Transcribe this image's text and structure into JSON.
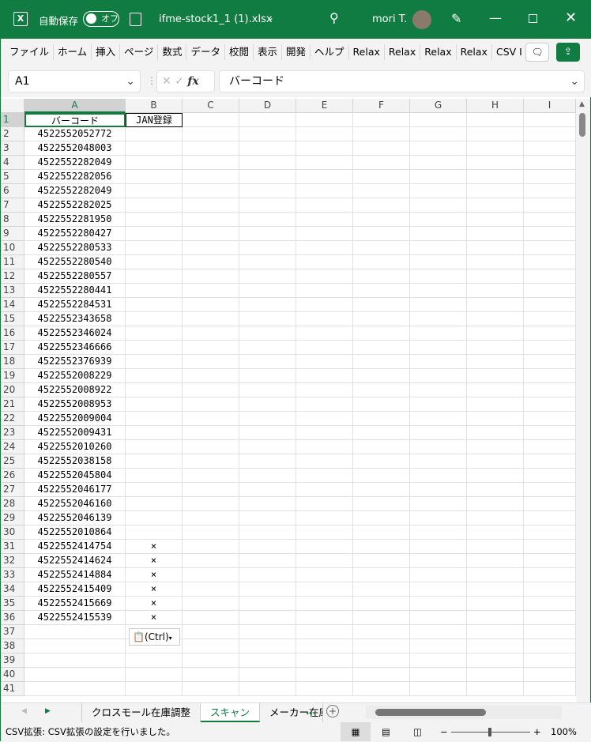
{
  "titlebar": {
    "autosave_label": "自動保存",
    "autosave_state": "オフ",
    "filename": "ifme-stock1_1 (1).xlsx",
    "user": "mori T."
  },
  "ribbon": {
    "tabs": [
      "ファイル",
      "ホーム",
      "挿入",
      "ページ",
      "数式",
      "データ",
      "校閲",
      "表示",
      "開発",
      "ヘルプ",
      "Relax",
      "Relax",
      "Relax",
      "Relax",
      "CSV I"
    ]
  },
  "formula": {
    "name_box": "A1",
    "fx": "fx",
    "content": "バーコード"
  },
  "columns": [
    "A",
    "B",
    "C",
    "D",
    "E",
    "F",
    "G",
    "H",
    "I"
  ],
  "rows": [
    [
      "バーコード",
      "JAN登録"
    ],
    [
      "4522552052772",
      ""
    ],
    [
      "4522552048003",
      ""
    ],
    [
      "4522552282049",
      ""
    ],
    [
      "4522552282056",
      ""
    ],
    [
      "4522552282049",
      ""
    ],
    [
      "4522552282025",
      ""
    ],
    [
      "4522552281950",
      ""
    ],
    [
      "4522552280427",
      ""
    ],
    [
      "4522552280533",
      ""
    ],
    [
      "4522552280540",
      ""
    ],
    [
      "4522552280557",
      ""
    ],
    [
      "4522552280441",
      ""
    ],
    [
      "4522552284531",
      ""
    ],
    [
      "4522552343658",
      ""
    ],
    [
      "4522552346024",
      ""
    ],
    [
      "4522552346666",
      ""
    ],
    [
      "4522552376939",
      ""
    ],
    [
      "4522552008229",
      ""
    ],
    [
      "4522552008922",
      ""
    ],
    [
      "4522552008953",
      ""
    ],
    [
      "4522552009004",
      ""
    ],
    [
      "4522552009431",
      ""
    ],
    [
      "4522552010260",
      ""
    ],
    [
      "4522552038158",
      ""
    ],
    [
      "4522552045804",
      ""
    ],
    [
      "4522552046177",
      ""
    ],
    [
      "4522552046160",
      ""
    ],
    [
      "4522552046139",
      ""
    ],
    [
      "4522552010864",
      ""
    ],
    [
      "4522552414754",
      "×"
    ],
    [
      "4522552414624",
      "×"
    ],
    [
      "4522552414884",
      "×"
    ],
    [
      "4522552415409",
      "×"
    ],
    [
      "4522552415669",
      "×"
    ],
    [
      "4522552415539",
      "×"
    ],
    [
      "",
      ""
    ],
    [
      "",
      ""
    ],
    [
      "",
      ""
    ],
    [
      "",
      ""
    ],
    [
      "",
      ""
    ]
  ],
  "paste_options": "(Ctrl)",
  "sheets": {
    "tabs": [
      "クロスモール在庫調整",
      "スキャン",
      "メーカー在庫"
    ],
    "active": 1,
    "more": "..."
  },
  "status": {
    "message": "CSV拡張: CSV拡張の設定を行いました。",
    "zoom": "100%",
    "zoom_minus": "−",
    "zoom_plus": "+"
  },
  "colors": {
    "brand": "#107c41"
  }
}
